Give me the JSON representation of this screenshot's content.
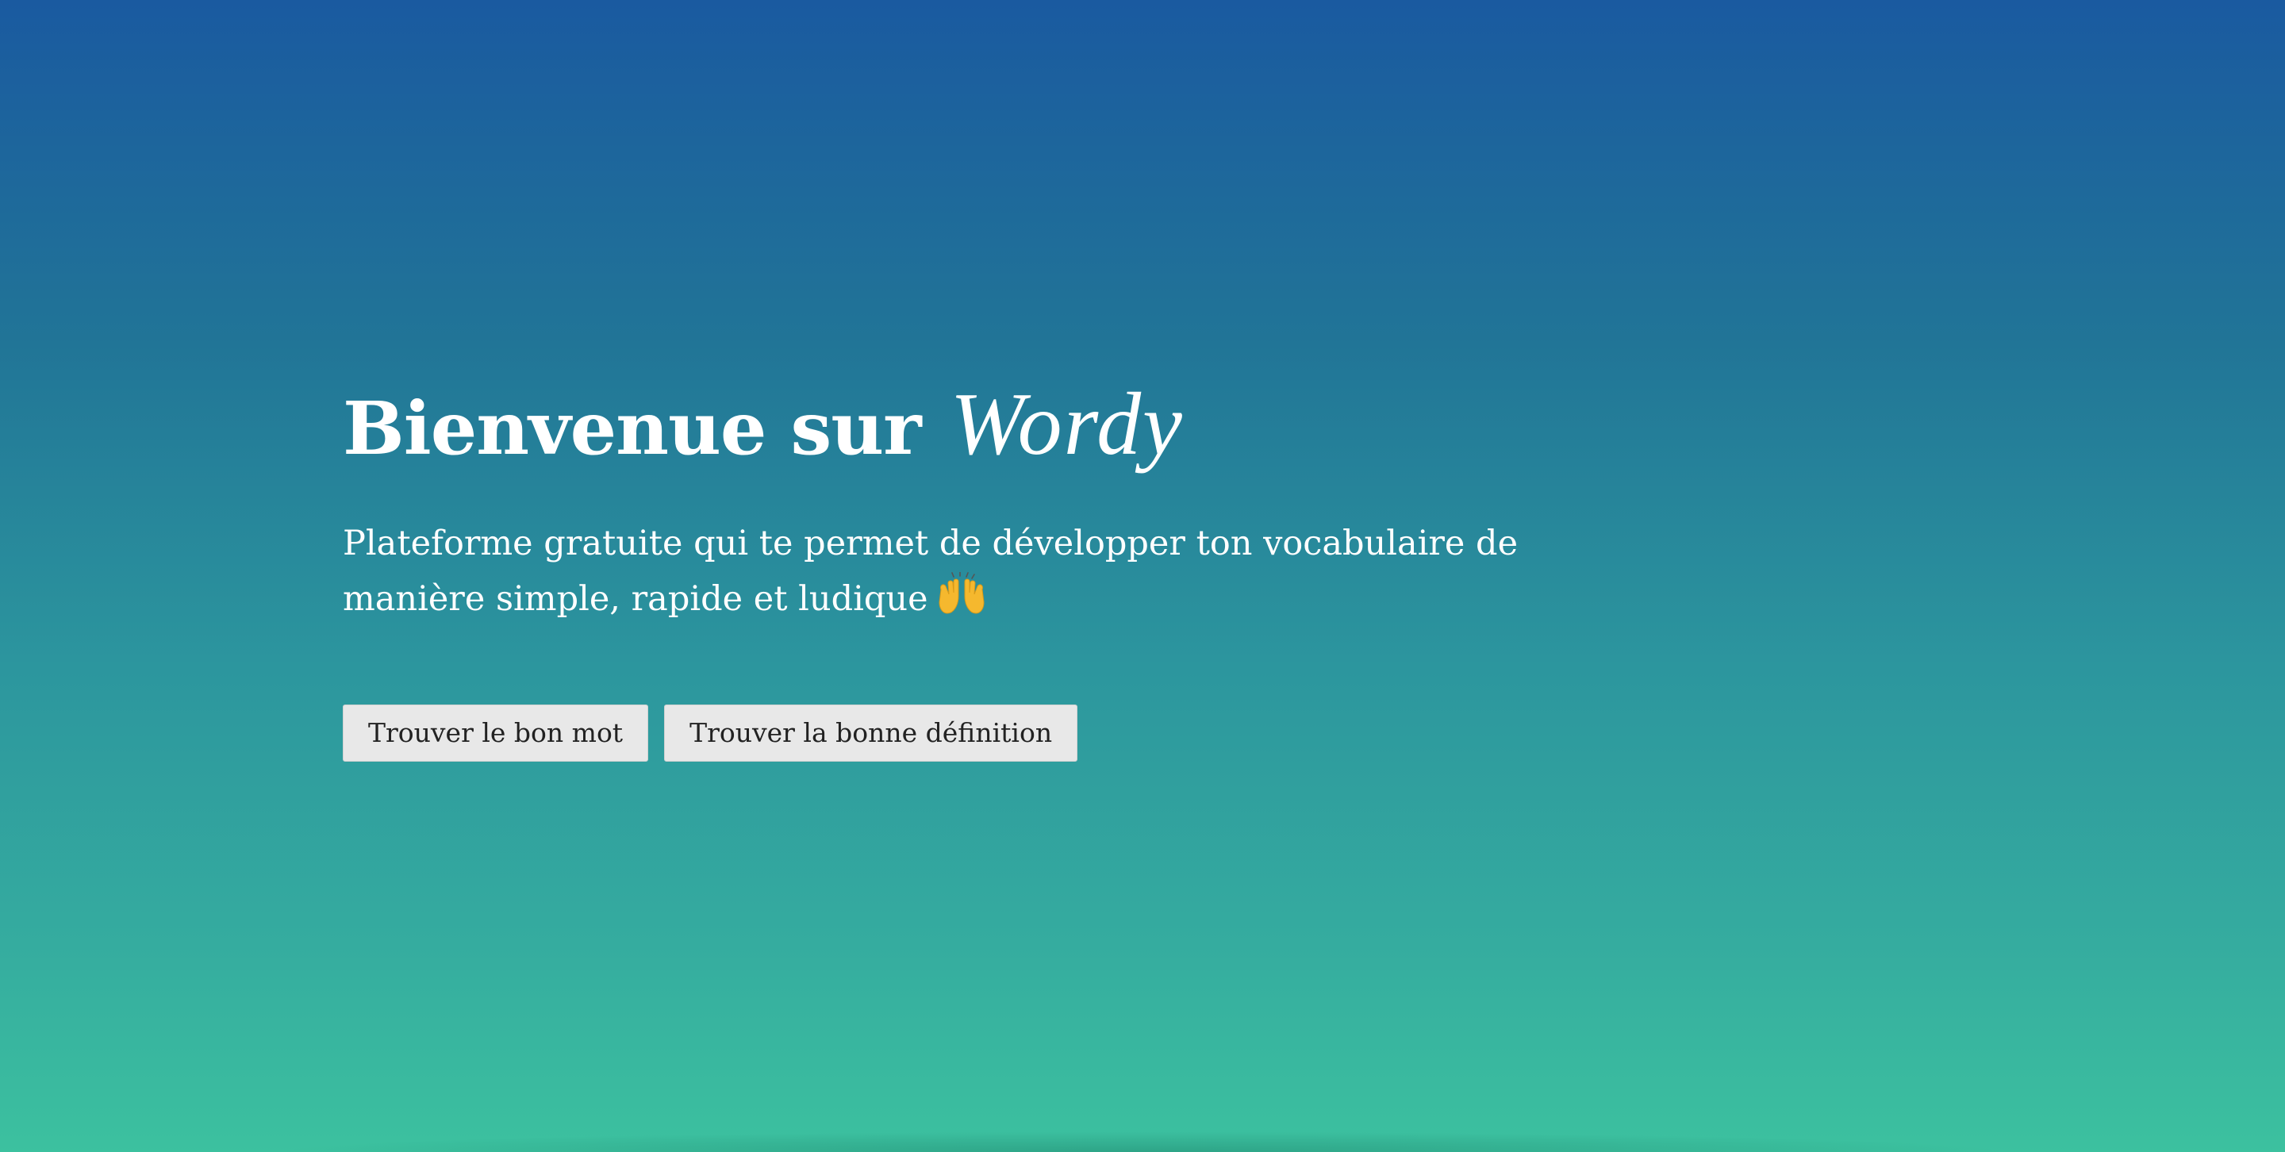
{
  "hero": {
    "title_prefix": "Bienvenue sur",
    "brand_name": "Wordy",
    "subtitle": "Plateforme gratuite qui te permet de développer ton vocabulaire de manière simple, rapide et ludique",
    "emoji_icon": "raising-hands-icon"
  },
  "actions": {
    "find_word_label": "Trouver le bon mot",
    "find_definition_label": "Trouver la bonne définition"
  },
  "colors": {
    "gradient_top": "#1a5aa0",
    "gradient_bottom": "#3cc19f",
    "button_bg": "#e8e8e8"
  }
}
